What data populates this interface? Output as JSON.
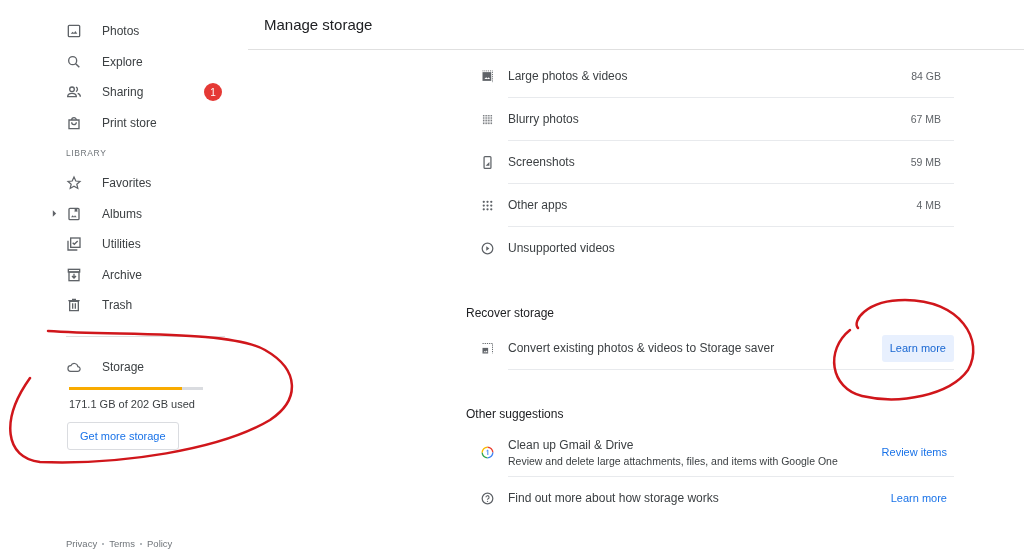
{
  "sidebar": {
    "items": [
      {
        "label": "Photos",
        "selected": false
      },
      {
        "label": "Explore",
        "selected": false
      },
      {
        "label": "Sharing",
        "badge": "1",
        "selected": false
      },
      {
        "label": "Print store",
        "selected": false
      },
      {
        "kind": "heading",
        "label": "LIBRARY"
      },
      {
        "label": "Favorites",
        "selected": false
      },
      {
        "label": "Albums",
        "expandable": true,
        "selected": false
      },
      {
        "label": "Utilities",
        "selected": false
      },
      {
        "label": "Archive",
        "selected": false
      },
      {
        "label": "Trash",
        "selected": false
      }
    ],
    "storage": {
      "label": "Storage",
      "level": 0.847,
      "usage": "171.1 GB of 202 GB used",
      "button": "Get more storage"
    },
    "footer": [
      "Privacy",
      "Terms",
      "Policy"
    ]
  },
  "header": {
    "title": "Manage storage"
  },
  "review": {
    "items": [
      {
        "label": "Large photos & videos",
        "size": "84 GB"
      },
      {
        "label": "Blurry photos",
        "size": "67 MB"
      },
      {
        "label": "Screenshots",
        "size": "59 MB"
      },
      {
        "label": "Other apps",
        "size": "4 MB"
      },
      {
        "label": "Unsupported videos"
      }
    ]
  },
  "recover": {
    "title": "Recover storage",
    "items": [
      {
        "label": "Convert existing photos & videos to Storage saver",
        "action": "Learn more",
        "kind": "tonal"
      }
    ]
  },
  "suggestions": {
    "title": "Other suggestions",
    "items": [
      {
        "label": "Clean up Gmail & Drive",
        "description": "Review and delete large attachments, files, and items with Google One",
        "action": "Review items",
        "kind": "text"
      },
      {
        "label": "Find out more about how storage works",
        "action": "Learn more",
        "kind": "text"
      }
    ]
  },
  "annotations": [
    {
      "color": "#d0161b"
    },
    {
      "color": "#d0161b"
    }
  ]
}
